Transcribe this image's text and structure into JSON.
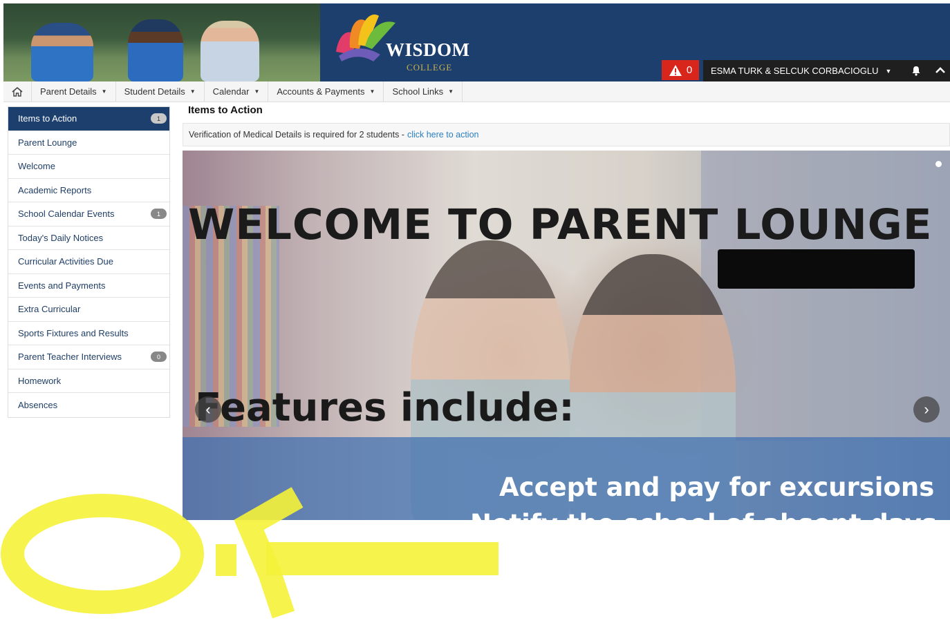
{
  "header": {
    "logo_title": "WISDOM",
    "logo_subtitle": "COLLEGE",
    "alert_count": "0",
    "alert_icon": "warning-icon",
    "user_name": "ESMA TURK & SELCUK CORBACIOGLU",
    "colors": {
      "bar": "#1d3f6e",
      "alert": "#d9261c",
      "user_menu": "#1f1f1f"
    }
  },
  "nav": {
    "home_icon": "home-icon",
    "items": [
      "Parent Details",
      "Student Details",
      "Calendar",
      "Accounts & Payments",
      "School Links"
    ]
  },
  "sidebar": {
    "items": [
      {
        "label": "Items to Action",
        "badge": "1",
        "active": true
      },
      {
        "label": "Parent Lounge"
      },
      {
        "label": "Welcome"
      },
      {
        "label": "Academic Reports"
      },
      {
        "label": "School Calendar Events",
        "badge": "1"
      },
      {
        "label": "Today's Daily Notices"
      },
      {
        "label": "Curricular Activities Due"
      },
      {
        "label": "Events and Payments"
      },
      {
        "label": "Extra Curricular"
      },
      {
        "label": "Sports Fixtures and Results"
      },
      {
        "label": "Parent Teacher Interviews",
        "badge": "0"
      },
      {
        "label": "Homework"
      },
      {
        "label": "Absences"
      }
    ]
  },
  "main": {
    "title": "Items to Action",
    "action_text": "Verification of Medical Details is required for 2 students -",
    "action_link": "click here to action",
    "carousel": {
      "heading": "WELCOME TO PARENT LOUNGE",
      "subheading": "Features include:",
      "band_line1": "Accept and pay for excursions",
      "band_line2": "Notify the school of absent days"
    }
  }
}
